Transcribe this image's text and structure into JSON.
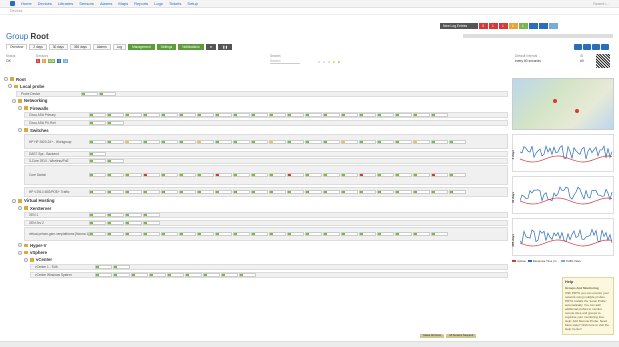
{
  "app": {
    "menu": [
      "Home",
      "Devices",
      "Libraries",
      "Sensors",
      "Alarms",
      "Maps",
      "Reports",
      "Logs",
      "Tickets",
      "Setup"
    ],
    "search_placeholder": "Search..."
  },
  "breadcrumb": "Devices",
  "status": [
    {
      "label": "New Log Entries",
      "color": "#555555"
    },
    {
      "label": "3",
      "color": "#d9383a"
    },
    {
      "label": "1",
      "color": "#d9383a"
    },
    {
      "label": "1",
      "color": "#d9383a"
    },
    {
      "label": "1",
      "color": "#e8a33c"
    },
    {
      "label": "1",
      "color": "#7ab648"
    },
    {
      "label": "",
      "color": "#2a6ebb"
    },
    {
      "label": "",
      "color": "#2a6ebb"
    },
    {
      "label": "",
      "color": "#7aaad8"
    }
  ],
  "page": {
    "prefix": "Group",
    "name": "Root"
  },
  "tabs": [
    "Overview",
    "2 days",
    "30 days",
    "365 days",
    "Alarms",
    "Log",
    "Management",
    "Settings",
    "Notifications"
  ],
  "info": {
    "status_label": "Status",
    "status_value": "OK",
    "sensors_label": "Sensors",
    "search_label": "Search",
    "search_placeholder": "Search",
    "default_interval_label": "Default Interval",
    "default_interval_value": "every 60 seconds",
    "id_label": "ID",
    "id_value": "#0"
  },
  "tree": {
    "root": "Root",
    "local_probe": "Local probe",
    "probe_device": "Probe Device",
    "networking": "Networking",
    "firewalls": "Firewalls",
    "switches": "Switches",
    "virtual_hosting": "Virtual Hosting",
    "xenserver": "XenServer",
    "hyperv": "Hyper-V",
    "vsphere": "vSphere",
    "vcenter": "vCenter",
    "devices": {
      "cisco_asa": "Cisco ASA Primary",
      "cisco_sf": "Cisco ASA PX-Roll",
      "hp_switch": "HP HP 2820-24+ - Workgroup",
      "dell": "DAS? Sys - Backend",
      "sw3": "3-Core 2910 - Wireless/PoE",
      "core": "Core Switch",
      "hp_a5800": "HP V1910 48G/POE+ Traffic",
      "xen1": "XEN 1",
      "xen2": "XEN Srv 2",
      "xen_vm": "virtual-pvhvm-gsm-xenplatforms [Norma 1] [Windows]",
      "vc1": "vCenter 1 - SVA",
      "vc2": "vCenter Windows System"
    }
  },
  "panel": {
    "map_label": "Geo Map",
    "g1_label": "2 days",
    "g2_label": "30 days",
    "g3_label": "365 days",
    "legend": [
      {
        "name": "Uptime",
        "color": "#d9383a"
      },
      {
        "name": "Response Time (m...",
        "color": "#2a6ebb"
      },
      {
        "name": "Traffic Index",
        "color": "#7aaad8"
      }
    ]
  },
  "help": {
    "title": "Help",
    "subtitle": "Groups And Monitoring",
    "body": "With PRTG you can monitor your network using multiple probes. PRTG installs the 'Local Probe' automatically. You can add additional probes to monitor remote sites and groups to organise your monitoring tree. Help: Add Remote Probe. Need More Help? Click here to visit the Help Center!"
  },
  "actions": [
    "Status All Down",
    "All Sensors Suspend"
  ]
}
